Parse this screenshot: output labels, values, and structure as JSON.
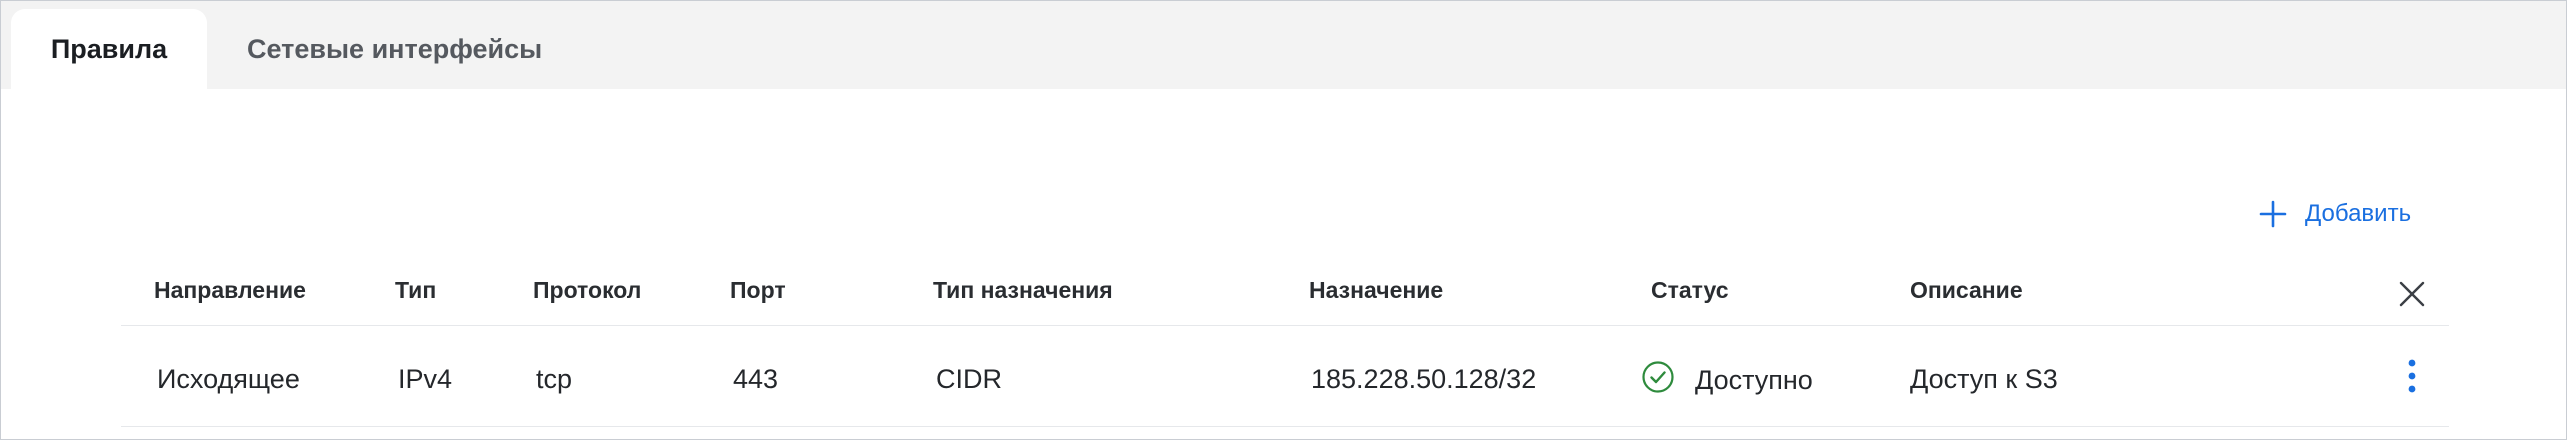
{
  "tabs": [
    {
      "label": "Правила",
      "active": true
    },
    {
      "label": "Сетевые интерфейсы",
      "active": false
    }
  ],
  "toolbar": {
    "add_label": "Добавить",
    "add_icon": "plus-icon",
    "accent_color": "#1a6fe0"
  },
  "table": {
    "columns": [
      "Направление",
      "Тип",
      "Протокол",
      "Порт",
      "Тип назначения",
      "Назначение",
      "Статус",
      "Описание"
    ],
    "close_icon": "close-icon",
    "rows": [
      {
        "direction": "Исходящее",
        "type": "IPv4",
        "protocol": "tcp",
        "port": "443",
        "dest_type": "CIDR",
        "destination": "185.228.50.128/32",
        "status": "Доступно",
        "status_icon": "check-circle-icon",
        "status_color": "#2e8b3d",
        "description": "Доступ к S3",
        "menu_icon": "more-vertical-icon"
      }
    ]
  }
}
